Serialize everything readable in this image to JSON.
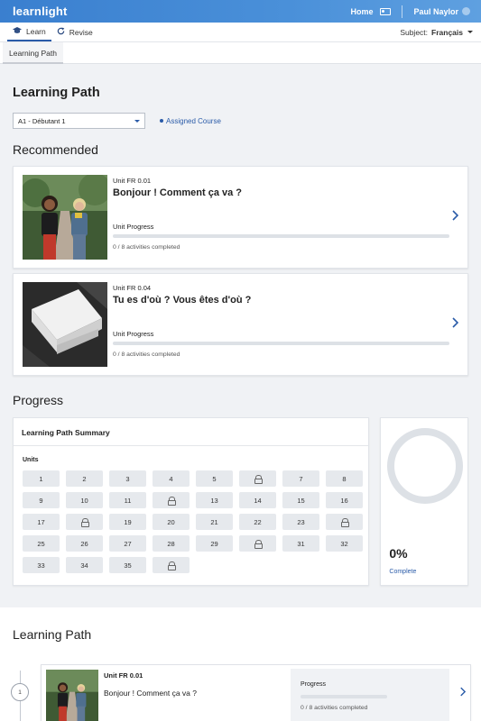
{
  "header": {
    "brand": "learnlight",
    "home_label": "Home",
    "user_name": "Paul Naylor"
  },
  "nav": {
    "tabs": [
      {
        "label": "Learn",
        "icon": "graduation-cap-icon",
        "active": true
      },
      {
        "label": "Revise",
        "icon": "refresh-icon",
        "active": false
      }
    ],
    "subject_label": "Subject:",
    "subject_value": "Français"
  },
  "subnav": {
    "tab": "Learning Path"
  },
  "page": {
    "title": "Learning Path",
    "level_select": "A1 - Débutant 1",
    "assigned_label": "Assigned Course"
  },
  "recommended": {
    "heading": "Recommended",
    "cards": [
      {
        "unit": "Unit FR 0.01",
        "title": "Bonjour ! Comment ça va ?",
        "progress_label": "Unit Progress",
        "progress": 0,
        "activities": "0 / 8 activities completed"
      },
      {
        "unit": "Unit FR 0.04",
        "title": "Tu es d'où ? Vous êtes d'où ?",
        "progress_label": "Unit Progress",
        "progress": 0,
        "activities": "0 / 8 activities completed"
      }
    ]
  },
  "progress": {
    "heading": "Progress",
    "summary_title": "Learning Path Summary",
    "units_label": "Units",
    "units": [
      "1",
      "2",
      "3",
      "4",
      "5",
      "lock",
      "7",
      "8",
      "9",
      "10",
      "11",
      "lock",
      "13",
      "14",
      "15",
      "16",
      "17",
      "lock",
      "19",
      "20",
      "21",
      "22",
      "23",
      "lock",
      "25",
      "26",
      "27",
      "28",
      "29",
      "lock",
      "31",
      "32",
      "33",
      "34",
      "35",
      "lock"
    ],
    "percent": "0%",
    "percent_value": 0,
    "complete_label": "Complete"
  },
  "learning_path": {
    "heading": "Learning Path",
    "items": [
      {
        "node": "1",
        "unit": "Unit FR 0.01",
        "title": "Bonjour ! Comment ça va ?",
        "progress_label": "Progress",
        "progress": 0,
        "activities": "0 / 8 activities completed"
      }
    ]
  },
  "colors": {
    "accent": "#2a5ba8",
    "topbar": "#4a90d9",
    "page_bg": "#f0f2f5"
  }
}
